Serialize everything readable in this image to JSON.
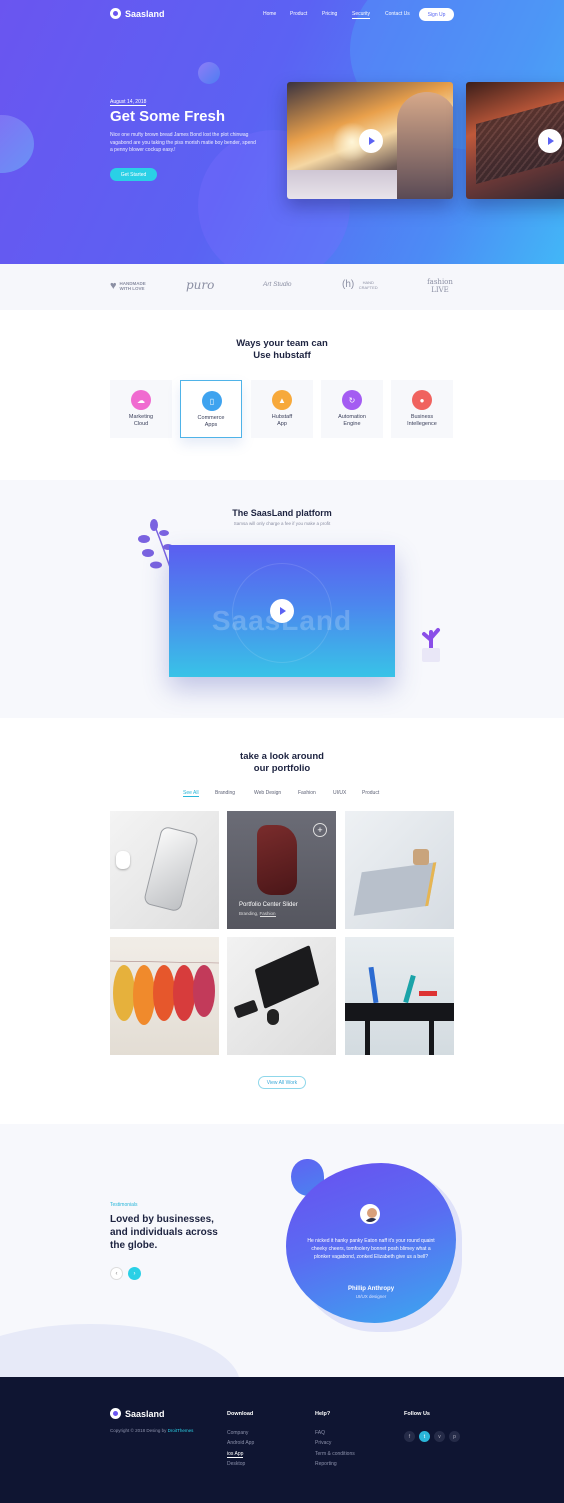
{
  "brand": {
    "name": "Saasland"
  },
  "nav": {
    "items": [
      "Home",
      "Product",
      "Pricing",
      "Security",
      "Contact Us"
    ],
    "signup": "Sign Up"
  },
  "hero": {
    "date": "August 14, 2018",
    "title": "Get Some Fresh",
    "body": "Nice one mufty brown bread James Bond lost the plot chinwag vagabond are you taking the piss morish matie boy bender, spend a penny blower cockup easy.!",
    "cta": "Get Started"
  },
  "partners": [
    {
      "name": "HANDMADE WITH LOVE"
    },
    {
      "name": "puro"
    },
    {
      "name": "Art Studio"
    },
    {
      "name": "HAND CRAFTED"
    },
    {
      "name": "fashion LIVE"
    }
  ],
  "ways": {
    "title_line1": "Ways your team can",
    "title_line2": "Use hubstaff",
    "items": [
      {
        "line1": "Marketing",
        "line2": "Cloud",
        "icon": "cloud-icon",
        "color": "#f06bd0"
      },
      {
        "line1": "Commerce",
        "line2": "Apps",
        "icon": "phone-icon",
        "color": "#3fa3ef"
      },
      {
        "line1": "Hubstaff",
        "line2": "App",
        "icon": "cap-icon",
        "color": "#f7a93b"
      },
      {
        "line1": "Automation",
        "line2": "Engine",
        "icon": "refresh-icon",
        "color": "#a45cf2"
      },
      {
        "line1": "Business",
        "line2": "Intellegence",
        "icon": "bulb-icon",
        "color": "#f0635f"
      }
    ]
  },
  "platform": {
    "title": "The SaasLand platform",
    "subtitle": "Samsa will only charge a fee if you make a profit",
    "watermark": "SaasLand"
  },
  "portfolio": {
    "title_line1": "take a look around",
    "title_line2": "our portfolio",
    "filters": [
      "See All",
      "Branding",
      "Web Design",
      "Fashion",
      "UI/UX",
      "Product"
    ],
    "featured": {
      "title": "Portfolio Center Slider",
      "tag1": "Branding,",
      "tag2": "Fashion"
    },
    "view_all": "View All Work"
  },
  "testimonial": {
    "eyebrow": "Testimonials",
    "line1": "Loved by businesses,",
    "line2": "and individuals across",
    "line3": "the globe.",
    "quote": "He nicked it hanky panky Eaton naff it's your round quaint cheeky cheers, tomfoolery bonnet posh blimey what a plonker vagabond, zonked Elizabeth give us a bell?",
    "author": "Phillip Anthropy",
    "role": "UI/UX designer"
  },
  "footer": {
    "copyright": "Copyright © 2018 Desing by",
    "copyright_brand": "DroitThemes",
    "cols": [
      {
        "title": "Download",
        "links": [
          "Company",
          "Android App",
          "ios App",
          "Desktop"
        ]
      },
      {
        "title": "Help?",
        "links": [
          "FAQ",
          "Privacy",
          "Term & conditions",
          "Reporting"
        ]
      }
    ],
    "follow": "Follow Us",
    "social": [
      "f",
      "t",
      "v",
      "p"
    ]
  },
  "colors": {
    "primary": "#5b62f3",
    "accent": "#2ad0e6",
    "dark": "#0f1532"
  }
}
